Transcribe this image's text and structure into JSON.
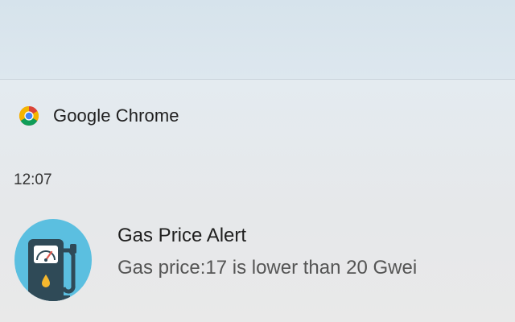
{
  "app": {
    "name": "Google Chrome",
    "icon": "chrome-logo-icon"
  },
  "notification": {
    "time": "12:07",
    "title": "Gas Price Alert",
    "body": "Gas price:17 is lower than 20 Gwei",
    "icon": "gas-pump-icon"
  },
  "colors": {
    "icon_bg": "#5bbfe0",
    "pump_body": "#2f4a57",
    "drop": "#f5b82e",
    "chrome_red": "#db4437",
    "chrome_yellow": "#f4b400",
    "chrome_green": "#0f9d58",
    "chrome_blue": "#4285f4"
  }
}
